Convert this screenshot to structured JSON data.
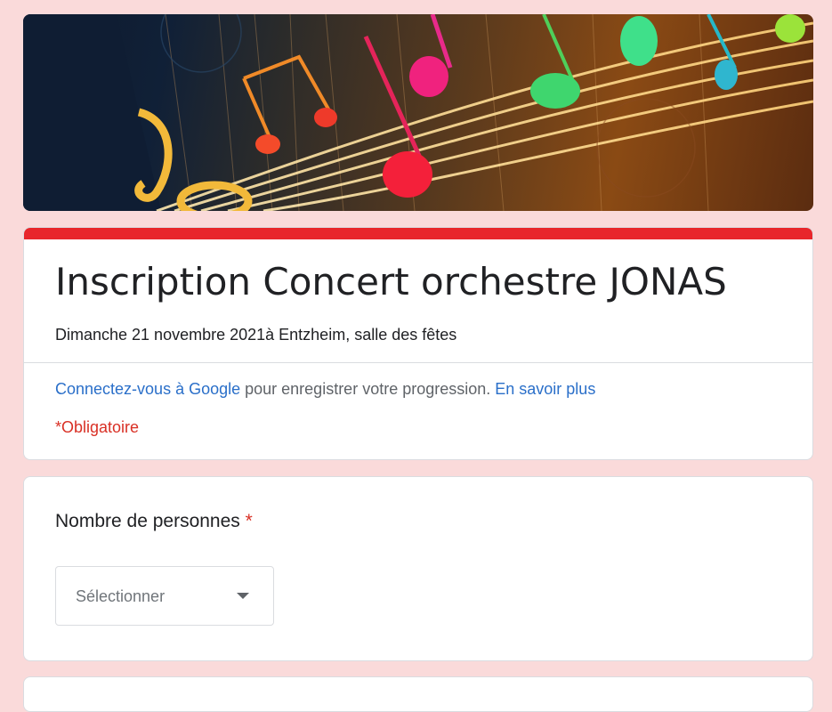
{
  "banner": {
    "alt": "music-notes-banner"
  },
  "form": {
    "accent_color": "#e8262b",
    "title": "Inscription Concert orchestre JONAS",
    "description": "Dimanche 21 novembre 2021à Entzheim, salle des fêtes",
    "signin_link": "Connectez-vous à Google",
    "signin_text": " pour enregistrer votre progression. ",
    "learn_more": "En savoir plus",
    "required_note": "*Obligatoire"
  },
  "question": {
    "label": "Nombre de personnes",
    "required_mark": "*",
    "select_placeholder": "Sélectionner",
    "caret_icon": "arrow-drop-down-icon"
  },
  "colors": {
    "background": "#fadada",
    "link": "#2a6fc9",
    "required": "#d93025"
  }
}
